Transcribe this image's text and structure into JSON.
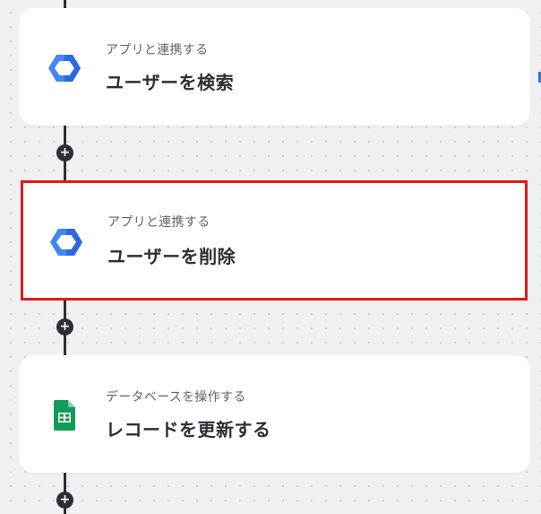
{
  "flow": {
    "steps": [
      {
        "subtitle": "アプリと連携する",
        "title": "ユーザーを検索",
        "icon": "google-workspace-hexagon-icon"
      },
      {
        "subtitle": "アプリと連携する",
        "title": "ユーザーを削除",
        "icon": "google-workspace-hexagon-icon",
        "selected": true
      },
      {
        "subtitle": "データベースを操作する",
        "title": "レコードを更新する",
        "icon": "google-sheets-icon"
      }
    ],
    "add_label": "+"
  },
  "colors": {
    "selection_border": "#e11a1a",
    "connector": "#2b2f36",
    "workspace_blue": "#4285f4",
    "sheets_green": "#0f9d58"
  }
}
